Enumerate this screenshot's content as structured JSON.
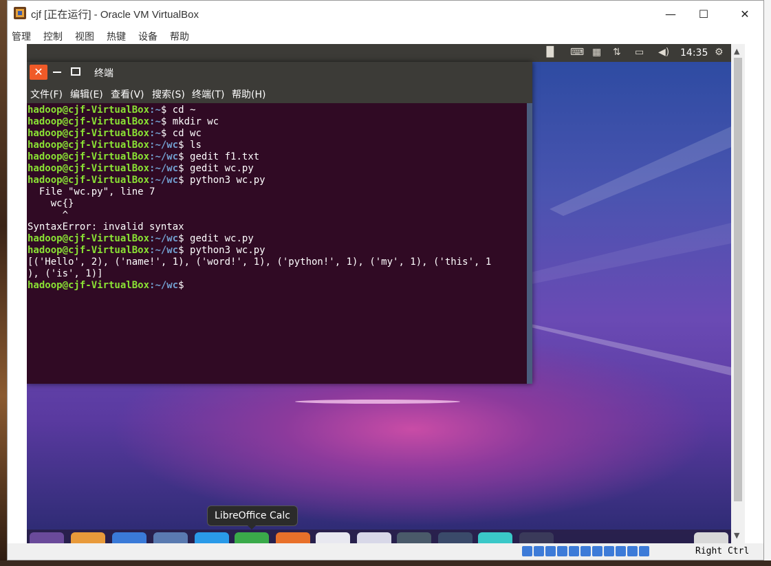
{
  "window": {
    "title": "cjf [正在运行] - Oracle VM VirtualBox",
    "minimize": "—",
    "maximize": "☐",
    "close": "✕"
  },
  "menu": [
    "管理",
    "控制",
    "视图",
    "热键",
    "设备",
    "帮助"
  ],
  "top_panel": {
    "clock": "14:35"
  },
  "terminal": {
    "title": "终端",
    "close": "✕",
    "menu": [
      "文件(F)",
      "编辑(E)",
      "查看(V)",
      "搜索(S)",
      "终端(T)",
      "帮助(H)"
    ],
    "lines": [
      {
        "user": "hadoop@cjf-VirtualBox",
        "path": ":~",
        "cmd": "$ cd ~"
      },
      {
        "user": "hadoop@cjf-VirtualBox",
        "path": ":~",
        "cmd": "$ mkdir wc"
      },
      {
        "user": "hadoop@cjf-VirtualBox",
        "path": ":~",
        "cmd": "$ cd wc"
      },
      {
        "user": "hadoop@cjf-VirtualBox",
        "path": ":~/wc",
        "cmd": "$ ls"
      },
      {
        "user": "hadoop@cjf-VirtualBox",
        "path": ":~/wc",
        "cmd": "$ gedit f1.txt"
      },
      {
        "user": "hadoop@cjf-VirtualBox",
        "path": ":~/wc",
        "cmd": "$ gedit wc.py"
      },
      {
        "user": "hadoop@cjf-VirtualBox",
        "path": ":~/wc",
        "cmd": "$ python3 wc.py"
      },
      {
        "text": "  File \"wc.py\", line 7"
      },
      {
        "text": "    wc{}"
      },
      {
        "text": "      ^"
      },
      {
        "text": "SyntaxError: invalid syntax"
      },
      {
        "user": "hadoop@cjf-VirtualBox",
        "path": ":~/wc",
        "cmd": "$ gedit wc.py"
      },
      {
        "user": "hadoop@cjf-VirtualBox",
        "path": ":~/wc",
        "cmd": "$ python3 wc.py"
      },
      {
        "text": "[('Hello', 2), ('name!', 1), ('word!', 1), ('python!', 1), ('my', 1), ('this', 1"
      },
      {
        "text": "), ('is', 1)]"
      },
      {
        "user": "hadoop@cjf-VirtualBox",
        "path": ":~/wc",
        "cmd": "$"
      }
    ]
  },
  "tooltip": "LibreOffice Calc",
  "statusbar": {
    "host_key": "Right Ctrl"
  }
}
